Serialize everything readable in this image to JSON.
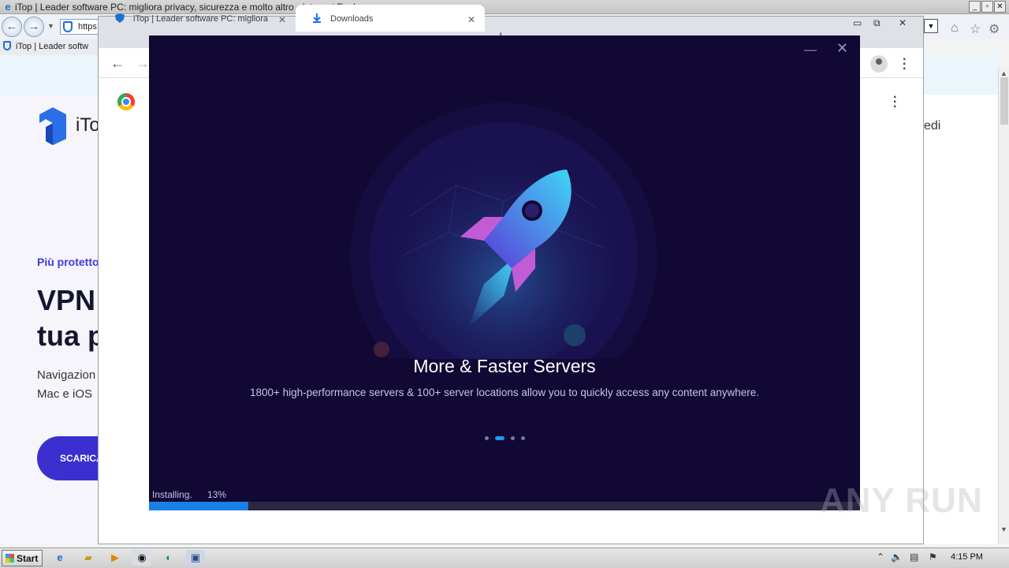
{
  "ie": {
    "title": "iTop | Leader software PC: migliora privacy, sicurezza e molto altro - Internet Explorer",
    "address": "https",
    "tab": "iTop | Leader softw",
    "page": {
      "brand": "iTo",
      "tagline": "Più protetto",
      "heading_line1": "VPN",
      "heading_line2": "tua p",
      "body_line1": "Navigazion",
      "body_line2": "Mac e iOS",
      "button": "SCARICA",
      "right_text": "edi"
    }
  },
  "chrome": {
    "tabs": [
      {
        "label": "iTop | Leader software PC: migliora"
      },
      {
        "label": "Downloads"
      }
    ]
  },
  "installer": {
    "slide_title": "More & Faster Servers",
    "slide_description": "1800+ high-performance servers & 100+ server locations allow you to quickly access any content anywhere.",
    "status_label": "Installing.",
    "progress_text": "13%",
    "progress_fraction": 0.14,
    "slide_count": 4,
    "active_slide": 2
  },
  "watermark": "ANY RUN",
  "taskbar": {
    "start_label": "Start",
    "clock": "4:15 PM"
  },
  "colors": {
    "installer_bg": "#110834",
    "progress_fill": "#1a7fe6",
    "accent_blue": "#3b2fd0"
  }
}
